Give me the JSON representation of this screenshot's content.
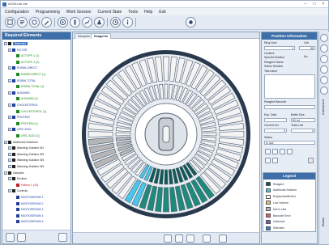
{
  "window": {
    "title": "ADVIA Lab Lite"
  },
  "menu": [
    "Configuration",
    "Programming",
    "Work Session",
    "Current State",
    "Tools",
    "Help",
    "Exit"
  ],
  "left_panel": {
    "title": "Required Elements",
    "tree": [
      {
        "label": "Selected",
        "depth": 0,
        "selected": true,
        "color": "#222"
      },
      {
        "label": "ROTOR",
        "depth": 1,
        "color": "#1f3fa0"
      },
      {
        "label": "ACTUPF-1 (1)",
        "depth": 2,
        "color": "#1a8a1a"
      },
      {
        "label": "ACTUPF-1 (2)",
        "depth": 2,
        "color": "#1a8a1a"
      },
      {
        "label": "ROBIN-DIRECT",
        "depth": 1,
        "color": "#1f3fa0"
      },
      {
        "label": "ROBIN-DIRECT (1)",
        "depth": 2,
        "color": "#1a8a1a"
      },
      {
        "label": "ROBIN-TOTAL",
        "depth": 1,
        "color": "#1f3fa0"
      },
      {
        "label": "ROBIN-TOTAL (1)",
        "depth": 2,
        "color": "#1a8a1a"
      },
      {
        "label": "ALBUMIN",
        "depth": 1,
        "color": "#1f3fa0"
      },
      {
        "label": "ALBUMIN (1)",
        "depth": 2,
        "color": "#1a8a1a"
      },
      {
        "label": "CHOLESTEROL",
        "depth": 1,
        "color": "#1f3fa0"
      },
      {
        "label": "CHOLESTEROL (1)",
        "depth": 2,
        "color": "#1a8a1a"
      },
      {
        "label": "PROTEIN",
        "depth": 1,
        "color": "#1f3fa0"
      },
      {
        "label": "PROTEIN (1)",
        "depth": 2,
        "color": "#1a8a1a"
      },
      {
        "label": "URIC ACID",
        "depth": 1,
        "color": "#1f3fa0"
      },
      {
        "label": "URIC ACID (1)",
        "depth": 2,
        "color": "#1a8a1a"
      },
      {
        "label": "Additional Solutions",
        "depth": 0,
        "color": "#222"
      },
      {
        "label": "Washing Solution W1",
        "depth": 1,
        "color": "#222"
      },
      {
        "label": "Washing Solution W2",
        "depth": 1,
        "color": "#222"
      },
      {
        "label": "Washing Solution W3",
        "depth": 1,
        "color": "#222"
      },
      {
        "label": "Washing Solution W4",
        "depth": 1,
        "color": "#222"
      },
      {
        "label": "Samples",
        "depth": 0,
        "color": "#222"
      },
      {
        "label": "Routine",
        "depth": 1,
        "color": "#222"
      },
      {
        "label": "Patient 1 (34)",
        "depth": 2,
        "color": "#c02020"
      },
      {
        "label": "Controls",
        "depth": 1,
        "color": "#222"
      },
      {
        "label": "MICROSERUM-1",
        "depth": 2,
        "color": "#1f3fa0"
      },
      {
        "label": "MICROSERUM-2",
        "depth": 2,
        "color": "#1f3fa0"
      },
      {
        "label": "MICROSERUM-3",
        "depth": 2,
        "color": "#1f3fa0"
      },
      {
        "label": "MICROSERUM-4",
        "depth": 2,
        "color": "#1f3fa0"
      },
      {
        "label": "MICROSERUM-5",
        "depth": 2,
        "color": "#1f3fa0"
      }
    ]
  },
  "center": {
    "tabs": [
      "Samples",
      "Reagents"
    ],
    "active_tab": "Reagents"
  },
  "right_panel": {
    "title": "Position Information",
    "ring_num_label": "Ring Num",
    "cell_label": "Cell",
    "ring_num_value": "1",
    "cell_value": "58",
    "content_label": "Content",
    "no_label": "No.",
    "content_value": "Special Solution",
    "reagent_name_label": "Reagent Name",
    "reagent_name_value": "Saline Solution",
    "test_name_label": "Test name",
    "reagent_barcode_label": "Reagent Barcode",
    "exp_date_label": "Exp. Date",
    "bottle_size_label": "Bottle Size",
    "bottle_size_value": "50 ml",
    "current_vol_label": "Current Vol.",
    "tests_left_label": "Tests Left",
    "tests_left_value": "0",
    "current_vol_value": "0",
    "status_label": "Status",
    "status_value": "In use"
  },
  "legend": {
    "title": "Legend",
    "items": [
      {
        "label": "Reagent",
        "color": "#0f5a52"
      },
      {
        "label": "Additional Solution",
        "color": "#49c6ea"
      },
      {
        "label": "Empty/Insufficient",
        "color": "#ffffff"
      },
      {
        "label": "Low Volume",
        "color": "#e8c66a"
      },
      {
        "label": "Not in Use",
        "color": "#b6b6b6"
      },
      {
        "label": "Barcode Error",
        "color": "#e25a5a"
      },
      {
        "label": "Unknown",
        "color": "#7a58b8"
      },
      {
        "label": "Selected",
        "color": "#2f7fe0"
      }
    ]
  },
  "side_strip": {
    "label_top": "Instrument",
    "label_bottom": "Status"
  },
  "colors": {
    "header": "#3f6fa8",
    "reagent": "#1f8a7a",
    "reagent_dark": "#0f5a52",
    "additional": "#49c6ea",
    "selected_cell": "#2f7fe0"
  },
  "icons": [
    "configuration-icon",
    "programming-icon",
    "work-session-icon",
    "current-state-icon",
    "tools-icon",
    "help-icon",
    "exit-icon"
  ]
}
